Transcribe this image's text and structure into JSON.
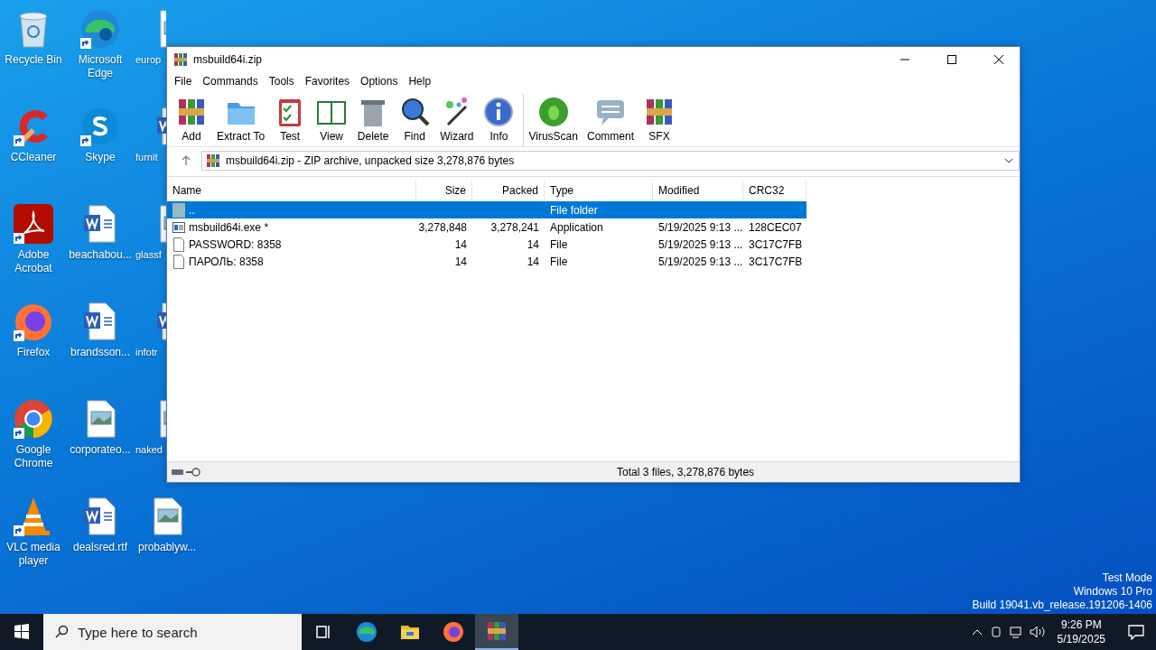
{
  "desktop_icons": [
    {
      "label": "Recycle Bin",
      "kind": "recycle",
      "shortcut": false,
      "cut": false
    },
    {
      "label": "CCleaner",
      "kind": "ccleaner",
      "shortcut": true,
      "cut": false
    },
    {
      "label": "Adobe Acrobat",
      "kind": "acrobat",
      "shortcut": true,
      "cut": false
    },
    {
      "label": "Firefox",
      "kind": "firefox",
      "shortcut": true,
      "cut": false
    },
    {
      "label": "Google Chrome",
      "kind": "chrome",
      "shortcut": true,
      "cut": false
    },
    {
      "label": "VLC media player",
      "kind": "vlc",
      "shortcut": true,
      "cut": false
    },
    {
      "label": "Microsoft Edge",
      "kind": "edge",
      "shortcut": true,
      "cut": false
    },
    {
      "label": "Skype",
      "kind": "skype",
      "shortcut": true,
      "cut": false
    },
    {
      "label": "beachabou...",
      "kind": "word",
      "shortcut": false,
      "cut": false
    },
    {
      "label": "brandsson...",
      "kind": "word",
      "shortcut": false,
      "cut": false
    },
    {
      "label": "corporateo...",
      "kind": "image",
      "shortcut": false,
      "cut": false
    },
    {
      "label": "dealsred.rtf",
      "kind": "word",
      "shortcut": false,
      "cut": false
    },
    {
      "label": "europ",
      "kind": "image",
      "shortcut": false,
      "cut": true
    },
    {
      "label": "furnit",
      "kind": "word",
      "shortcut": false,
      "cut": true
    },
    {
      "label": "glassf",
      "kind": "image",
      "shortcut": false,
      "cut": true
    },
    {
      "label": "infotr",
      "kind": "word",
      "shortcut": false,
      "cut": true
    },
    {
      "label": "naked",
      "kind": "image",
      "shortcut": false,
      "cut": true
    },
    {
      "label": "probablyw...",
      "kind": "image",
      "shortcut": false,
      "cut": false
    }
  ],
  "window": {
    "title": "msbuild64i.zip",
    "menu": [
      "File",
      "Commands",
      "Tools",
      "Favorites",
      "Options",
      "Help"
    ],
    "toolbar": [
      {
        "label": "Add",
        "kind": "add"
      },
      {
        "label": "Extract To",
        "kind": "extract"
      },
      {
        "label": "Test",
        "kind": "test"
      },
      {
        "label": "View",
        "kind": "view"
      },
      {
        "label": "Delete",
        "kind": "delete"
      },
      {
        "label": "Find",
        "kind": "find"
      },
      {
        "label": "Wizard",
        "kind": "wizard"
      },
      {
        "label": "Info",
        "kind": "info"
      },
      {
        "label": "VirusScan",
        "kind": "virus"
      },
      {
        "label": "Comment",
        "kind": "comment"
      },
      {
        "label": "SFX",
        "kind": "sfx"
      }
    ],
    "address": "msbuild64i.zip - ZIP archive, unpacked size 3,278,876 bytes",
    "table": {
      "columns": [
        "Name",
        "Size",
        "Packed",
        "Type",
        "Modified",
        "CRC32"
      ],
      "rows": [
        {
          "kind": "folder",
          "selected": true,
          "cells": [
            "..",
            "",
            "",
            "File folder",
            "",
            ""
          ]
        },
        {
          "kind": "exe",
          "selected": false,
          "cells": [
            "msbuild64i.exe *",
            "3,278,848",
            "3,278,241",
            "Application",
            "5/19/2025 9:13 ...",
            "128CEC07"
          ]
        },
        {
          "kind": "file",
          "selected": false,
          "cells": [
            "PASSWORD: 8358",
            "14",
            "14",
            "File",
            "5/19/2025 9:13 ...",
            "3C17C7FB"
          ]
        },
        {
          "kind": "file",
          "selected": false,
          "cells": [
            "ПАРОЛЬ: 8358",
            "14",
            "14",
            "File",
            "5/19/2025 9:13 ...",
            "3C17C7FB"
          ]
        }
      ]
    },
    "status_bar": "Total 3 files, 3,278,876 bytes"
  },
  "desktop_info": [
    "Test Mode",
    "Windows 10 Pro",
    "Build 19041.vb_release.191206-1406"
  ],
  "taskbar": {
    "search_placeholder": "Type here to search",
    "apps": [
      {
        "kind": "edge",
        "selected": false
      },
      {
        "kind": "explorer",
        "selected": false
      },
      {
        "kind": "firefox",
        "selected": false
      },
      {
        "kind": "winrar",
        "selected": true
      }
    ],
    "time": "9:26 PM",
    "date": "5/19/2025"
  }
}
